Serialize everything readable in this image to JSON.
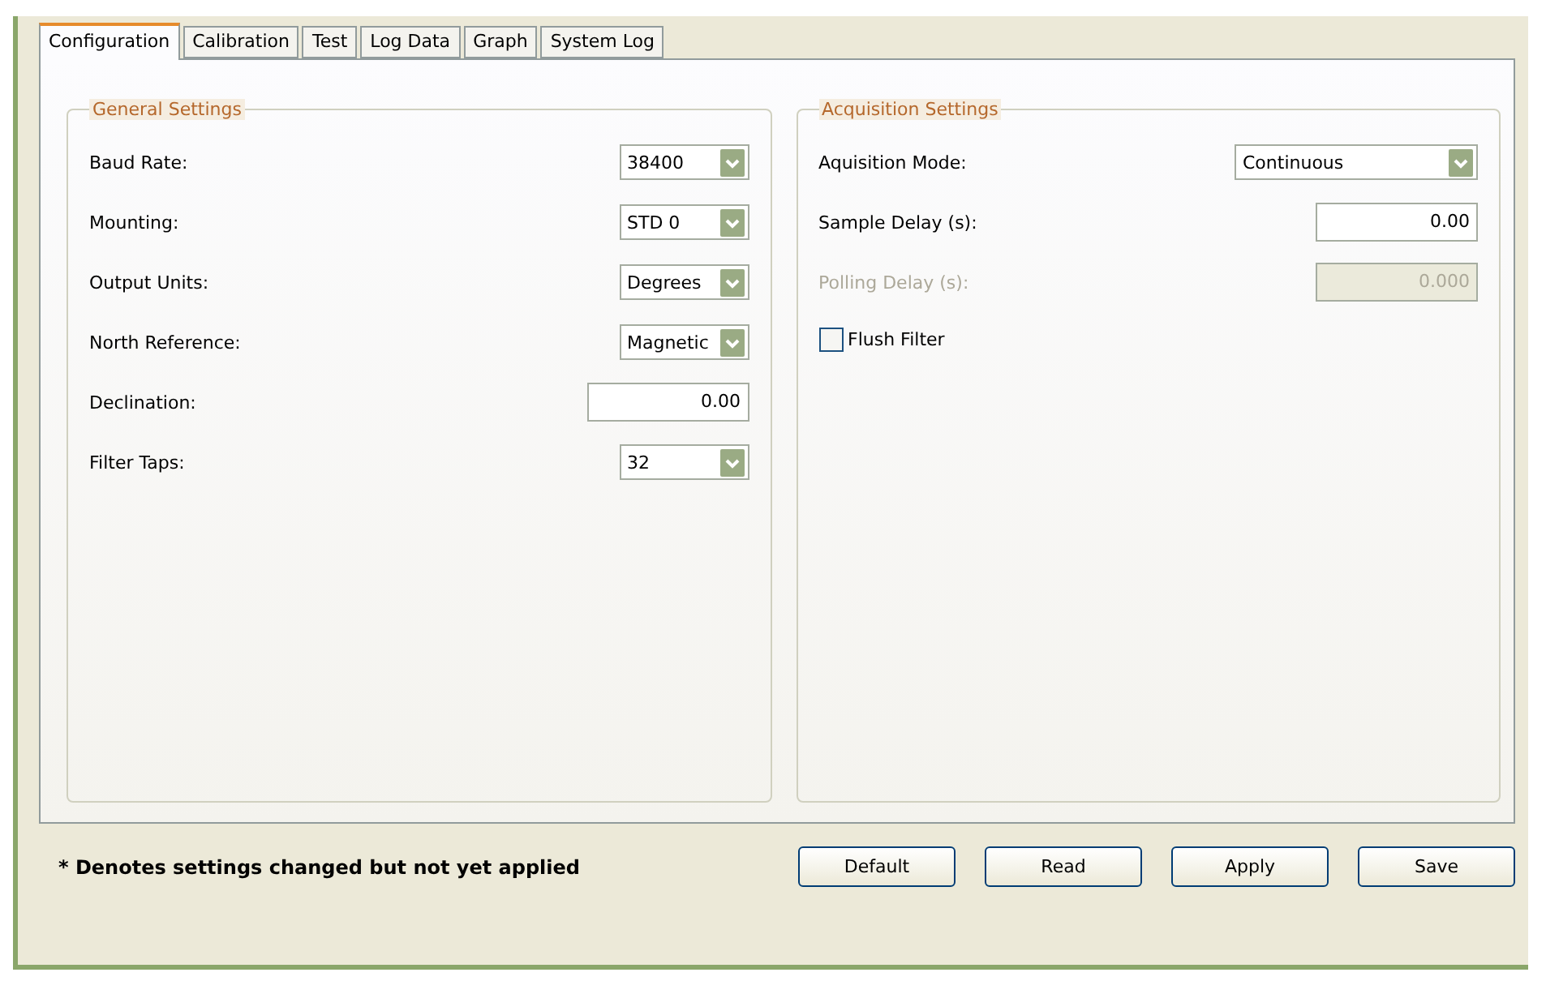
{
  "tabs": [
    {
      "label": "Configuration",
      "selected": true
    },
    {
      "label": "Calibration",
      "selected": false
    },
    {
      "label": "Test",
      "selected": false
    },
    {
      "label": "Log Data",
      "selected": false
    },
    {
      "label": "Graph",
      "selected": false
    },
    {
      "label": "System Log",
      "selected": false
    }
  ],
  "groups": [
    {
      "title": "General Settings",
      "rows": [
        {
          "kind": "select",
          "label": "Baud Rate:",
          "value": "38400",
          "wide": false
        },
        {
          "kind": "select",
          "label": "Mounting:",
          "value": "STD 0",
          "wide": false
        },
        {
          "kind": "select",
          "label": "Output Units:",
          "value": "Degrees",
          "wide": false
        },
        {
          "kind": "select",
          "label": "North Reference:",
          "value": "Magnetic",
          "wide": false
        },
        {
          "kind": "text",
          "label": "Declination:",
          "value": "0.00",
          "disabled": false
        },
        {
          "kind": "select",
          "label": "Filter Taps:",
          "value": "32",
          "wide": false
        }
      ]
    },
    {
      "title": "Acquisition Settings",
      "rows": [
        {
          "kind": "select",
          "label": "Aquisition Mode:",
          "value": "Continuous",
          "wide": true
        },
        {
          "kind": "text",
          "label": "Sample Delay (s):",
          "value": "0.00",
          "disabled": false
        },
        {
          "kind": "text",
          "label": "Polling Delay (s):",
          "value": "0.000",
          "disabled": true
        },
        {
          "kind": "check",
          "label": "Flush Filter",
          "checked": false
        }
      ]
    }
  ],
  "note": "* Denotes settings changed but not yet applied",
  "buttons": [
    "Default",
    "Read",
    "Apply",
    "Save"
  ]
}
